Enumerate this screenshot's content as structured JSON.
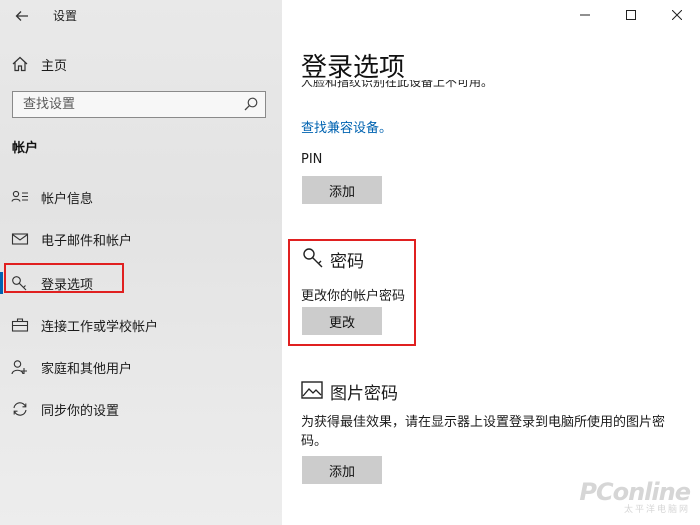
{
  "window": {
    "title": "设置"
  },
  "sidebar": {
    "home_label": "主页",
    "search_placeholder": "查找设置",
    "section_title": "帐户",
    "items": [
      {
        "label": "帐户信息",
        "icon": "person-card-icon"
      },
      {
        "label": "电子邮件和帐户",
        "icon": "mail-icon"
      },
      {
        "label": "登录选项",
        "icon": "key-icon",
        "active": true
      },
      {
        "label": "连接工作或学校帐户",
        "icon": "briefcase-icon"
      },
      {
        "label": "家庭和其他用户",
        "icon": "person-add-icon"
      },
      {
        "label": "同步你的设置",
        "icon": "sync-icon"
      }
    ]
  },
  "main": {
    "title": "登录选项",
    "clipped_text": "人脸和指纹识别在此设备上不可用。",
    "compat_link": "查找兼容设备。",
    "pin": {
      "label": "PIN",
      "button": "添加"
    },
    "password": {
      "title": "密码",
      "description": "更改你的帐户密码",
      "button": "更改"
    },
    "picture_password": {
      "title": "图片密码",
      "description": "为获得最佳效果，请在显示器上设置登录到电脑所使用的图片密码。",
      "button": "添加"
    }
  },
  "watermark": {
    "main": "PConline",
    "sub": "太平洋电脑网"
  },
  "colors": {
    "accent": "#0063b1",
    "highlight": "#e02020",
    "button_bg": "#cccccc"
  }
}
